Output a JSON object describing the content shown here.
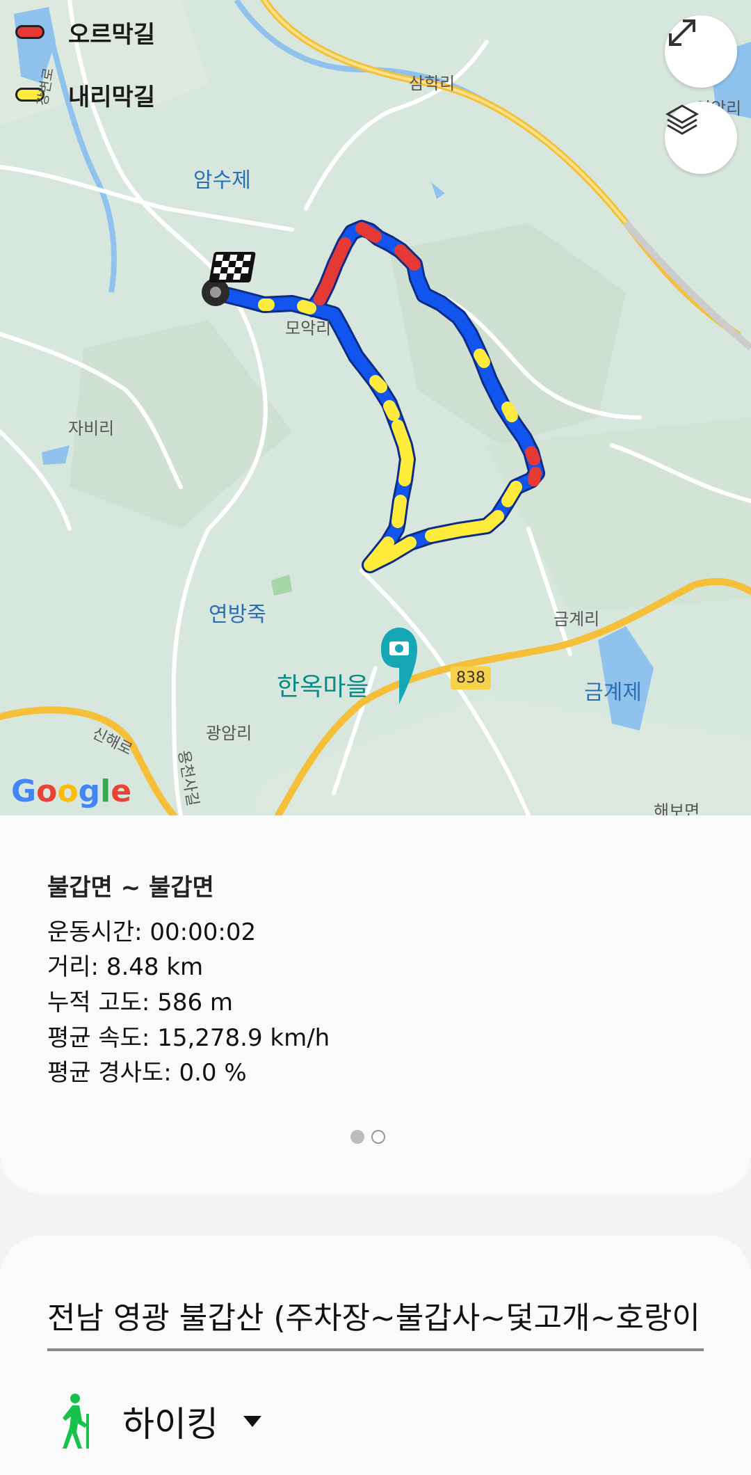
{
  "legend": {
    "uphill_label": "오르막길",
    "downhill_label": "내리막길",
    "uphill_color": "#e53935",
    "downhill_color": "#ffeb3b"
  },
  "route_colors": {
    "flat": "#1155ee",
    "uphill": "#e53935",
    "downhill": "#ffeb3b"
  },
  "map": {
    "labels": {
      "samhak": "삼학리",
      "amsu": "암수제",
      "moak": "모악리",
      "jabi": "자비리",
      "yeonbang": "연방죽",
      "hanok": "한옥마을",
      "geumgye_ri": "금계리",
      "geumgye_je": "금계제",
      "gwangam": "광암리",
      "sinhae": "신해로",
      "yongcheon": "용천사길",
      "haebo": "해보면",
      "yeonghu": "영악리",
      "gangbyeon": "강변로"
    },
    "road_number": "838",
    "attribution": "Google",
    "icons": [
      "expand-icon",
      "layers-icon",
      "finish-flag-icon",
      "start-marker-icon",
      "camera-pin-icon"
    ]
  },
  "summary": {
    "title": "불갑면 ~ 불갑면",
    "duration": "운동시간: 00:00:02",
    "distance": "거리: 8.48 km",
    "elevation": "누적 고도: 586 m",
    "avg_speed": "평균 속도: 15,278.9 km/h",
    "avg_slope": "평균 경사도: 0.0 %",
    "page_index": 1,
    "page_count": 2
  },
  "form": {
    "course_name": "전남 영광 불갑산 (주차장~불갑사~덫고개~호랑이",
    "activity": "하이킹",
    "activity_icon": "hiking-icon"
  }
}
